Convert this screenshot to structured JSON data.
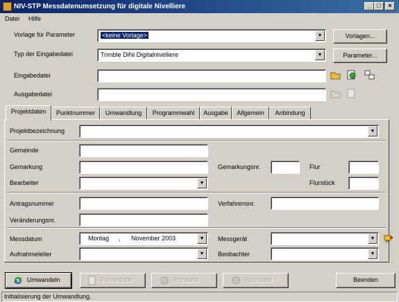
{
  "window": {
    "title": "NIV-STP Messdatenumsetzung für digitale Nivelliere",
    "minimize": "_",
    "maximize": "□",
    "close": "×"
  },
  "menu": {
    "file": "Datei",
    "help": "Hilfe"
  },
  "top": {
    "vorlage_label": "Vorlage für Parameter",
    "vorlage_value": "<keine Vorlage>",
    "vorlagen_button": "Vorlagen...",
    "typ_label": "Typ der Eingabedatei",
    "typ_value": "Trimble DiNi Digitalnivelliere",
    "parameter_button": "Parameter...",
    "eingabe_label": "Eingabedatei",
    "eingabe_value": "",
    "ausgabe_label": "Ausgabedatei",
    "ausgabe_value": ""
  },
  "tabs": [
    "Projektdaten",
    "Punktnummer",
    "Umwandlung",
    "Programmwahl",
    "Ausgabe",
    "Allgemein",
    "Anbindung"
  ],
  "form": {
    "projekt_label": "Projektbezeichnung",
    "gemeinde_label": "Gemeinde",
    "gemarkung_label": "Gemarkung",
    "gemarkungsnr_label": "Gemarkungsnr.",
    "flur_label": "Flur",
    "bearbeiter_label": "Bearbeiter",
    "flurstueck_label": "Flurstück",
    "antragsnummer_label": "Antragsnummer",
    "verfahrensnr_label": "Verfahrensnr.",
    "veraenderungsnr_label": "Veränderungsnr.",
    "messdatum_label": "Messdatum",
    "messdatum_day": "Montag",
    "messdatum_sep": ",",
    "messdatum_value": "November 2003",
    "messgeraet_label": "Messgerät",
    "aufnahmeleiter_label": "Aufnahmeleiter",
    "beobachter_label": "Beobachter"
  },
  "buttons": {
    "umwandeln": "Umwandeln",
    "fehlerdatei": "Fehlerdatei",
    "rohdatei": "Rohdatei",
    "reindatei": "Reindatei",
    "beenden": "Beenden"
  },
  "status": "Initialisierung der Umwandlung.",
  "colors": {
    "titlebar": "#0a246a",
    "face": "#d4d0c8",
    "selection": "#0a246a"
  }
}
